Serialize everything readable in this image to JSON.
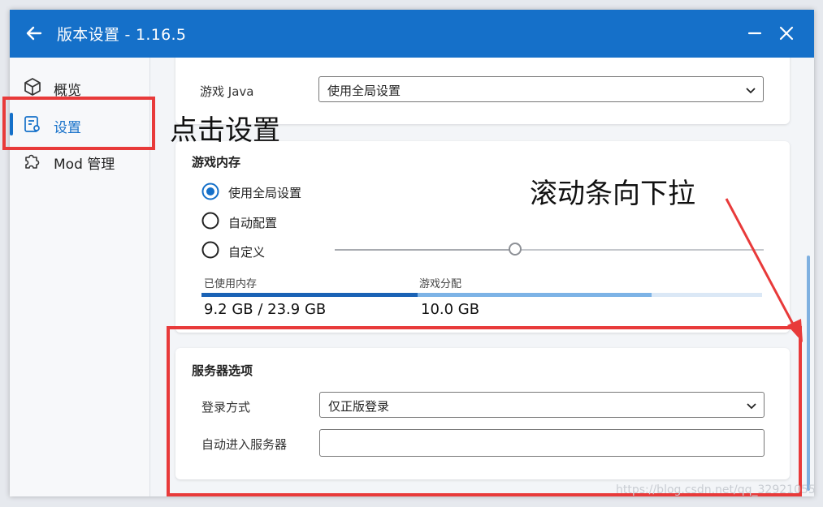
{
  "window": {
    "title": "版本设置 - 1.16.5",
    "accent": "#1570c9"
  },
  "sidebar": {
    "items": [
      {
        "label": "概览",
        "icon": "cube-icon"
      },
      {
        "label": "设置",
        "icon": "settings-page-icon",
        "active": true
      },
      {
        "label": "Mod 管理",
        "icon": "puzzle-icon"
      }
    ]
  },
  "java": {
    "label": "游戏 Java",
    "selected": "使用全局设置"
  },
  "memory": {
    "title": "游戏内存",
    "options": [
      {
        "label": "使用全局设置",
        "selected": true
      },
      {
        "label": "自动配置",
        "selected": false
      },
      {
        "label": "自定义",
        "selected": false
      }
    ],
    "slider_fraction": 0.42,
    "used_label": "已使用内存",
    "used_value": "9.2 GB / 23.9 GB",
    "used_fraction": 0.385,
    "alloc_label": "游戏分配",
    "alloc_value": "10.0 GB",
    "alloc_fraction": 0.803
  },
  "server": {
    "title": "服务器选项",
    "login_label": "登录方式",
    "login_selected": "仅正版登录",
    "autojoin_label": "自动进入服务器",
    "autojoin_value": ""
  },
  "annotations": {
    "click_settings": "点击设置",
    "scroll_down": "滚动条向下拉",
    "color": "#e83a3a"
  },
  "watermark": "https://blog.csdn.net/qq_32921055"
}
